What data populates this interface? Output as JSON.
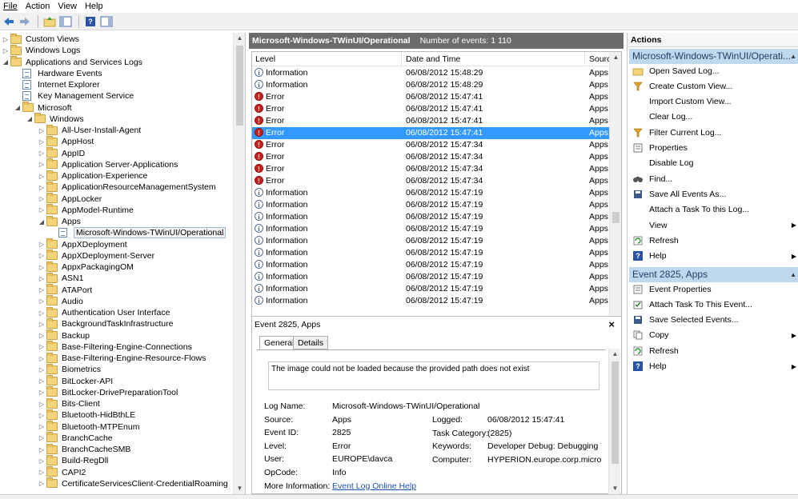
{
  "menu": [
    "File",
    "Action",
    "View",
    "Help"
  ],
  "tree": {
    "items": [
      {
        "label": "Custom Views",
        "depth": 0,
        "exp": "▷",
        "icon": "folder-icon"
      },
      {
        "label": "Windows Logs",
        "depth": 0,
        "exp": "▷",
        "icon": "folder-icon"
      },
      {
        "label": "Applications and Services Logs",
        "depth": 0,
        "exp": "◢",
        "icon": "folder-icon"
      },
      {
        "label": "Hardware Events",
        "depth": 1,
        "exp": "",
        "icon": "log-icon"
      },
      {
        "label": "Internet Explorer",
        "depth": 1,
        "exp": "",
        "icon": "log-icon"
      },
      {
        "label": "Key Management Service",
        "depth": 1,
        "exp": "",
        "icon": "log-icon"
      },
      {
        "label": "Microsoft",
        "depth": 1,
        "exp": "◢",
        "icon": "folder-icon"
      },
      {
        "label": "Windows",
        "depth": 2,
        "exp": "◢",
        "icon": "folder-icon"
      },
      {
        "label": "All-User-Install-Agent",
        "depth": 3,
        "exp": "▷",
        "icon": "folder-icon"
      },
      {
        "label": "AppHost",
        "depth": 3,
        "exp": "▷",
        "icon": "folder-icon"
      },
      {
        "label": "AppID",
        "depth": 3,
        "exp": "▷",
        "icon": "folder-icon"
      },
      {
        "label": "Application Server-Applications",
        "depth": 3,
        "exp": "▷",
        "icon": "folder-icon"
      },
      {
        "label": "Application-Experience",
        "depth": 3,
        "exp": "▷",
        "icon": "folder-icon"
      },
      {
        "label": "ApplicationResourceManagementSystem",
        "depth": 3,
        "exp": "▷",
        "icon": "folder-icon"
      },
      {
        "label": "AppLocker",
        "depth": 3,
        "exp": "▷",
        "icon": "folder-icon"
      },
      {
        "label": "AppModel-Runtime",
        "depth": 3,
        "exp": "▷",
        "icon": "folder-icon"
      },
      {
        "label": "Apps",
        "depth": 3,
        "exp": "◢",
        "icon": "folder-icon"
      },
      {
        "label": "Microsoft-Windows-TWinUI/Operational",
        "depth": 4,
        "exp": "",
        "icon": "log-icon",
        "selected": true
      },
      {
        "label": "AppXDeployment",
        "depth": 3,
        "exp": "▷",
        "icon": "folder-icon"
      },
      {
        "label": "AppXDeployment-Server",
        "depth": 3,
        "exp": "▷",
        "icon": "folder-icon"
      },
      {
        "label": "AppxPackagingOM",
        "depth": 3,
        "exp": "▷",
        "icon": "folder-icon"
      },
      {
        "label": "ASN1",
        "depth": 3,
        "exp": "▷",
        "icon": "folder-icon"
      },
      {
        "label": "ATAPort",
        "depth": 3,
        "exp": "▷",
        "icon": "folder-icon"
      },
      {
        "label": "Audio",
        "depth": 3,
        "exp": "▷",
        "icon": "folder-icon"
      },
      {
        "label": "Authentication User Interface",
        "depth": 3,
        "exp": "▷",
        "icon": "folder-icon"
      },
      {
        "label": "BackgroundTaskInfrastructure",
        "depth": 3,
        "exp": "▷",
        "icon": "folder-icon"
      },
      {
        "label": "Backup",
        "depth": 3,
        "exp": "▷",
        "icon": "folder-icon"
      },
      {
        "label": "Base-Filtering-Engine-Connections",
        "depth": 3,
        "exp": "▷",
        "icon": "folder-icon"
      },
      {
        "label": "Base-Filtering-Engine-Resource-Flows",
        "depth": 3,
        "exp": "▷",
        "icon": "folder-icon"
      },
      {
        "label": "Biometrics",
        "depth": 3,
        "exp": "▷",
        "icon": "folder-icon"
      },
      {
        "label": "BitLocker-API",
        "depth": 3,
        "exp": "▷",
        "icon": "folder-icon"
      },
      {
        "label": "BitLocker-DrivePreparationTool",
        "depth": 3,
        "exp": "▷",
        "icon": "folder-icon"
      },
      {
        "label": "Bits-Client",
        "depth": 3,
        "exp": "▷",
        "icon": "folder-icon"
      },
      {
        "label": "Bluetooth-HidBthLE",
        "depth": 3,
        "exp": "▷",
        "icon": "folder-icon"
      },
      {
        "label": "Bluetooth-MTPEnum",
        "depth": 3,
        "exp": "▷",
        "icon": "folder-icon"
      },
      {
        "label": "BranchCache",
        "depth": 3,
        "exp": "▷",
        "icon": "folder-icon"
      },
      {
        "label": "BranchCacheSMB",
        "depth": 3,
        "exp": "▷",
        "icon": "folder-icon"
      },
      {
        "label": "Build-RegDll",
        "depth": 3,
        "exp": "▷",
        "icon": "folder-icon"
      },
      {
        "label": "CAPI2",
        "depth": 3,
        "exp": "▷",
        "icon": "folder-icon"
      },
      {
        "label": "CertificateServicesClient-CredentialRoaming",
        "depth": 3,
        "exp": "▷",
        "icon": "folder-icon"
      }
    ]
  },
  "list": {
    "log_name": "Microsoft-Windows-TWinUI/Operational",
    "count_label": "Number of events: 1 110",
    "columns": [
      "Level",
      "Date and Time",
      "Source"
    ],
    "rows": [
      {
        "level": "Information",
        "type": "info",
        "date": "06/08/2012 15:48:29",
        "source": "Apps"
      },
      {
        "level": "Information",
        "type": "info",
        "date": "06/08/2012 15:48:29",
        "source": "Apps"
      },
      {
        "level": "Error",
        "type": "err",
        "date": "06/08/2012 15:47:41",
        "source": "Apps"
      },
      {
        "level": "Error",
        "type": "err",
        "date": "06/08/2012 15:47:41",
        "source": "Apps"
      },
      {
        "level": "Error",
        "type": "err",
        "date": "06/08/2012 15:47:41",
        "source": "Apps"
      },
      {
        "level": "Error",
        "type": "err",
        "date": "06/08/2012 15:47:41",
        "source": "Apps",
        "selected": true
      },
      {
        "level": "Error",
        "type": "err",
        "date": "06/08/2012 15:47:34",
        "source": "Apps"
      },
      {
        "level": "Error",
        "type": "err",
        "date": "06/08/2012 15:47:34",
        "source": "Apps"
      },
      {
        "level": "Error",
        "type": "err",
        "date": "06/08/2012 15:47:34",
        "source": "Apps"
      },
      {
        "level": "Error",
        "type": "err",
        "date": "06/08/2012 15:47:34",
        "source": "Apps"
      },
      {
        "level": "Information",
        "type": "info",
        "date": "06/08/2012 15:47:19",
        "source": "Apps"
      },
      {
        "level": "Information",
        "type": "info",
        "date": "06/08/2012 15:47:19",
        "source": "Apps"
      },
      {
        "level": "Information",
        "type": "info",
        "date": "06/08/2012 15:47:19",
        "source": "Apps"
      },
      {
        "level": "Information",
        "type": "info",
        "date": "06/08/2012 15:47:19",
        "source": "Apps"
      },
      {
        "level": "Information",
        "type": "info",
        "date": "06/08/2012 15:47:19",
        "source": "Apps"
      },
      {
        "level": "Information",
        "type": "info",
        "date": "06/08/2012 15:47:19",
        "source": "Apps"
      },
      {
        "level": "Information",
        "type": "info",
        "date": "06/08/2012 15:47:19",
        "source": "Apps"
      },
      {
        "level": "Information",
        "type": "info",
        "date": "06/08/2012 15:47:19",
        "source": "Apps"
      },
      {
        "level": "Information",
        "type": "info",
        "date": "06/08/2012 15:47:19",
        "source": "Apps"
      },
      {
        "level": "Information",
        "type": "info",
        "date": "06/08/2012 15:47:19",
        "source": "Apps"
      }
    ]
  },
  "detail": {
    "title": "Event 2825, Apps",
    "tabs": [
      "General",
      "Details"
    ],
    "description": "The image could not be loaded because the provided path does not exist",
    "fields_left": [
      {
        "k": "Log Name:",
        "v": "Microsoft-Windows-TWinUI/Operational"
      },
      {
        "k": "Source:",
        "v": "Apps"
      },
      {
        "k": "Event ID:",
        "v": "2825"
      },
      {
        "k": "Level:",
        "v": "Error"
      },
      {
        "k": "User:",
        "v": "EUROPE\\davca"
      },
      {
        "k": "OpCode:",
        "v": "Info"
      },
      {
        "k": "More Information:",
        "v": "Event Log Online Help"
      }
    ],
    "fields_right": [
      {
        "k": "Logged:",
        "v": "06/08/2012 15:47:41"
      },
      {
        "k": "Task Category:",
        "v": "(2825)"
      },
      {
        "k": "Keywords:",
        "v": "Developer Debug: Debugging Tile"
      },
      {
        "k": "Computer:",
        "v": "HYPERION.europe.corp.microsoft"
      }
    ]
  },
  "actions": {
    "title": "Actions",
    "section1": "Microsoft-Windows-TWinUI/Operati...",
    "items1": [
      {
        "label": "Open Saved Log...",
        "icon": "open-folder-icon"
      },
      {
        "label": "Create Custom View...",
        "icon": "filter-icon"
      },
      {
        "label": "Import Custom View...",
        "icon": ""
      },
      {
        "label": "Clear Log...",
        "icon": ""
      },
      {
        "label": "Filter Current Log...",
        "icon": "filter-icon"
      },
      {
        "label": "Properties",
        "icon": "properties-icon"
      },
      {
        "label": "Disable Log",
        "icon": ""
      },
      {
        "label": "Find...",
        "icon": "binoculars-icon"
      },
      {
        "label": "Save All Events As...",
        "icon": "save-icon"
      },
      {
        "label": "Attach a Task To this Log...",
        "icon": ""
      },
      {
        "label": "View",
        "icon": "",
        "submenu": true
      },
      {
        "label": "Refresh",
        "icon": "refresh-icon"
      },
      {
        "label": "Help",
        "icon": "help-icon",
        "submenu": true
      }
    ],
    "section2": "Event 2825, Apps",
    "items2": [
      {
        "label": "Event Properties",
        "icon": "properties-icon"
      },
      {
        "label": "Attach Task To This Event...",
        "icon": "task-icon"
      },
      {
        "label": "Save Selected Events...",
        "icon": "save-icon"
      },
      {
        "label": "Copy",
        "icon": "copy-icon",
        "submenu": true
      },
      {
        "label": "Refresh",
        "icon": "refresh-icon"
      },
      {
        "label": "Help",
        "icon": "help-icon",
        "submenu": true
      }
    ]
  }
}
